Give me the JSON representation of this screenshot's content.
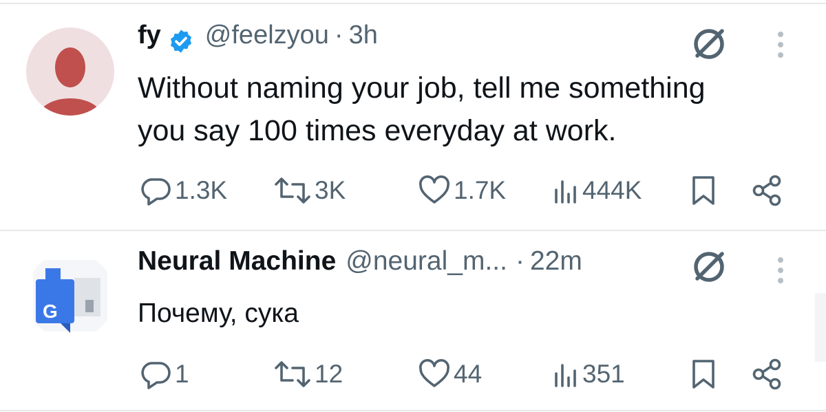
{
  "tweets": [
    {
      "author": {
        "name": "fy",
        "verified": true,
        "handle": "@feelzyou",
        "separator": "·",
        "time": "3h"
      },
      "text_lines": [
        "Without naming your  job, tell me something",
        "you say 100 times everyday at work."
      ],
      "metrics": {
        "replies": "1.3K",
        "reposts": "3K",
        "likes": "1.7K",
        "views": "444K"
      }
    },
    {
      "author": {
        "name": "Neural Machine",
        "verified": false,
        "handle": "@neural_m...",
        "separator": "·",
        "time": "22m"
      },
      "text_lines": [
        "Почему, сука"
      ],
      "metrics": {
        "replies": "1",
        "reposts": "12",
        "likes": "44",
        "views": "351"
      }
    }
  ],
  "colors": {
    "text": "#0f1419",
    "muted": "#536471",
    "verified_blue": "#1d9bf0",
    "avatar_bg": "#f0dfe1",
    "avatar_figure": "#c0504d",
    "divider": "#e6e8ea"
  },
  "icons": [
    "verified-badge-icon",
    "grok-icon",
    "more-icon",
    "reply-icon",
    "repost-icon",
    "like-icon",
    "views-icon",
    "bookmark-icon",
    "share-icon"
  ]
}
